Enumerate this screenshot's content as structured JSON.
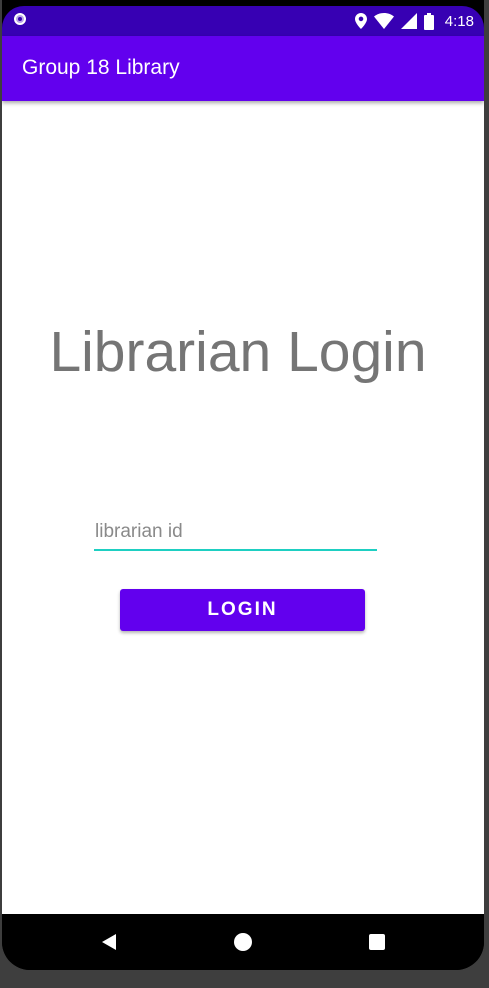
{
  "status_bar": {
    "time": "4:18",
    "icons": [
      "notification-circle-icon",
      "location-icon",
      "wifi-icon",
      "signal-icon",
      "battery-icon"
    ]
  },
  "app_bar": {
    "title": "Group 18 Library"
  },
  "login": {
    "heading": "Librarian Login",
    "id_field": {
      "value": "",
      "placeholder": "librarian id"
    },
    "button_label": "LOGIN"
  },
  "nav_bar": {
    "icons": [
      "back-icon",
      "home-icon",
      "recents-icon"
    ]
  },
  "colors": {
    "primary": "#6200EE",
    "primary_dark": "#3700B3",
    "accent": "#1ecfc2",
    "heading_text": "#757575"
  }
}
